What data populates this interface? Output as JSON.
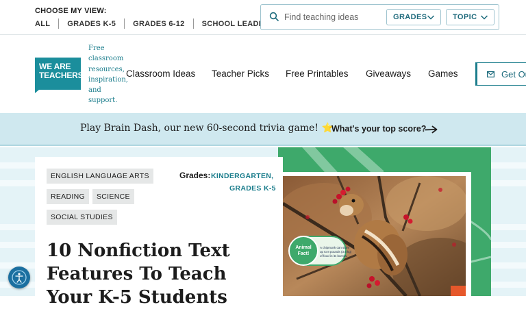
{
  "topbar": {
    "view_label": "CHOOSE MY VIEW:",
    "views": [
      "ALL",
      "GRADES K-5",
      "GRADES 6-12",
      "SCHOOL LEADERS"
    ],
    "search_placeholder": "Find teaching ideas",
    "grades_dropdown": "GRADES",
    "topic_dropdown": "TOPIC"
  },
  "brand": {
    "logo_line1": "WE ARE",
    "logo_line2": "TEACHERS",
    "tagline": [
      "Free",
      "classroom",
      "resources,",
      "inspiration,",
      "and",
      "support."
    ],
    "brand_color": "#1b8e9c"
  },
  "nav": {
    "items": [
      "Classroom Ideas",
      "Teacher Picks",
      "Free Printables",
      "Giveaways",
      "Games"
    ],
    "cta": "Get Ou"
  },
  "promo": {
    "text": "Play Brain Dash, our new 60-second trivia game! ⭐",
    "link": "What's your top score?",
    "bg_color": "#cfe8ef"
  },
  "article": {
    "tags": [
      "ENGLISH LANGUAGE ARTS",
      "READING",
      "SCIENCE",
      "SOCIAL STUDIES"
    ],
    "grades_label": "Grades:",
    "grades": [
      "KINDERGARTEN,",
      "GRADES K-5"
    ],
    "title": "10 Nonfiction Text Features To Teach Your K-5 Students",
    "image_badge_title": "Animal Fact!",
    "image_badge_text": "A chipmunk can store up to 8 pounds (3.6 kg) of food in its burrow."
  },
  "icons": {
    "search": "search-icon",
    "chevron": "chevron-down-icon",
    "mail": "mail-icon",
    "arrow": "arrow-right-icon",
    "accessibility": "accessibility-icon"
  }
}
